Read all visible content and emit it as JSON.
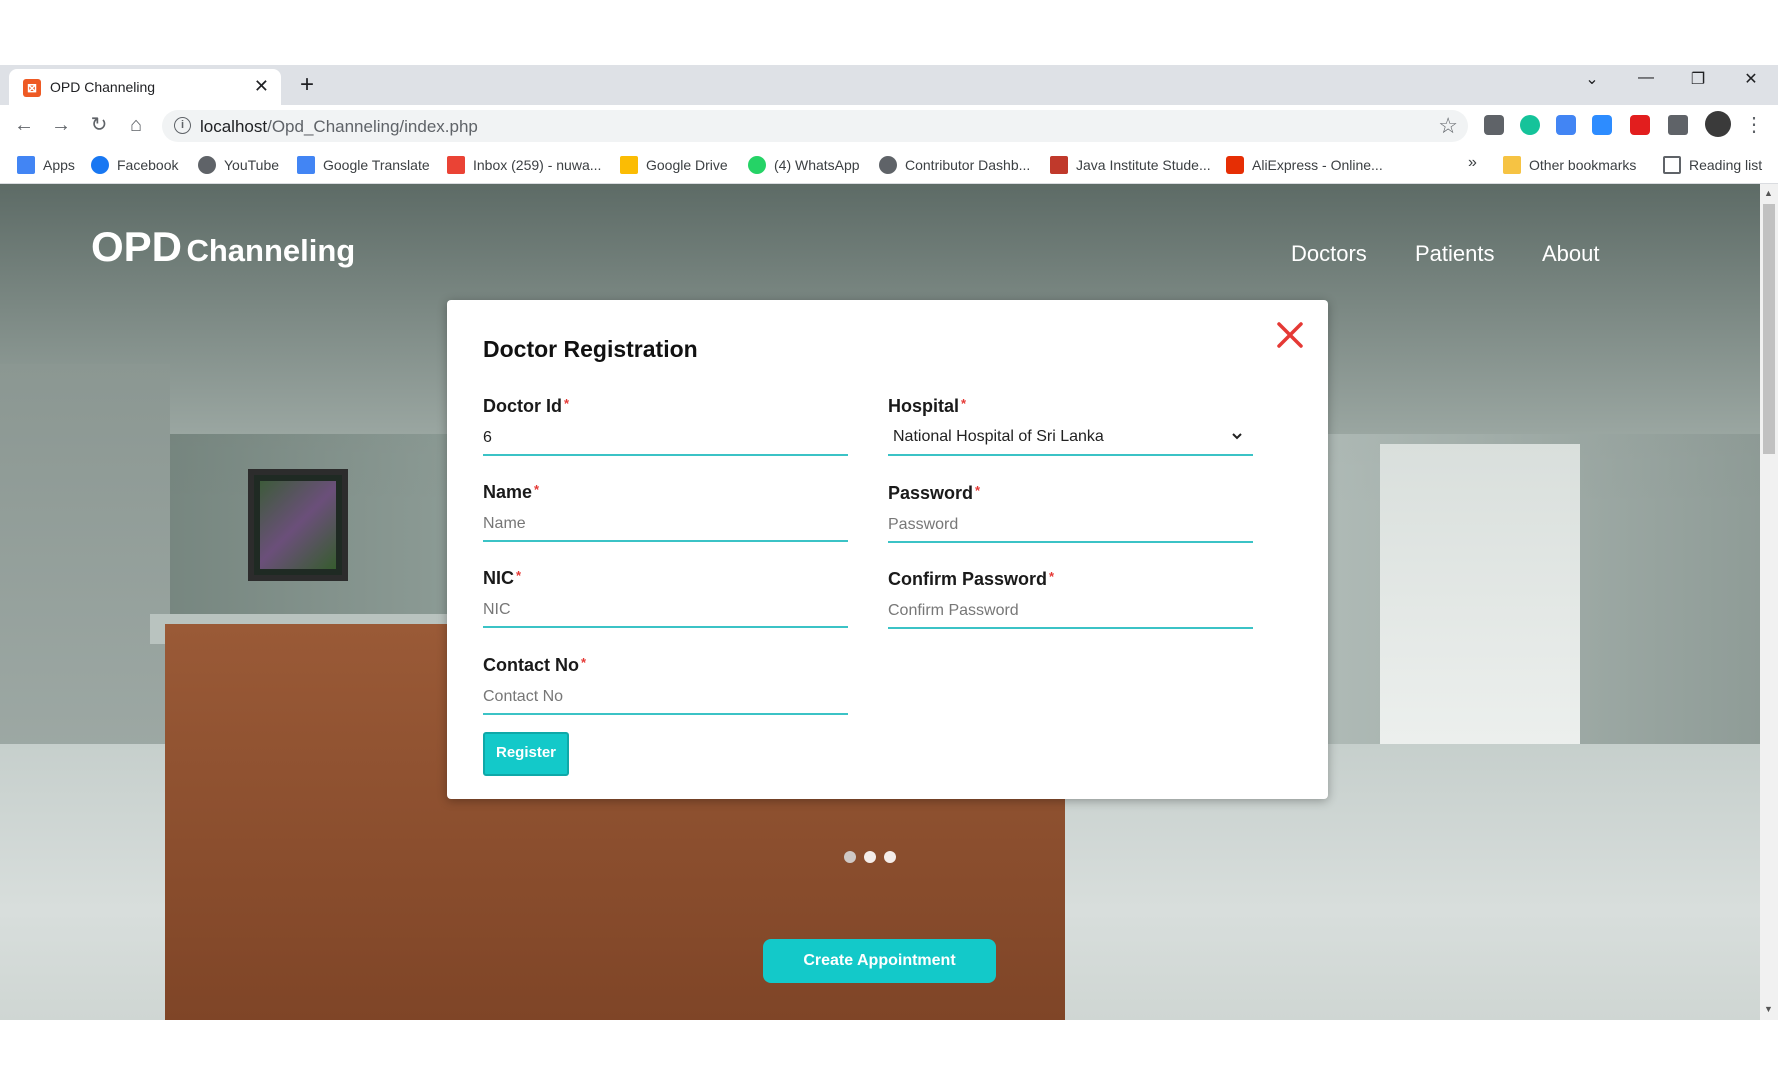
{
  "browser": {
    "tab_title": "OPD Channeling",
    "tab_close": "✕",
    "new_tab": "+",
    "url_host": "localhost",
    "url_path": "/Opd_Channeling/index.php",
    "bookmarks": [
      {
        "label": "Apps",
        "color": "#4285f4"
      },
      {
        "label": "Facebook",
        "color": "#1877f2"
      },
      {
        "label": "YouTube",
        "color": "#5f6368"
      },
      {
        "label": "Google Translate",
        "color": "#4285f4"
      },
      {
        "label": "Inbox (259) - nuwa...",
        "color": "#ea4335"
      },
      {
        "label": "Google Drive",
        "color": "#fbbc04"
      },
      {
        "label": "(4) WhatsApp",
        "color": "#25d366"
      },
      {
        "label": "Contributor Dashb...",
        "color": "#5f6368"
      },
      {
        "label": "Java Institute Stude...",
        "color": "#c0392b"
      },
      {
        "label": "AliExpress - Online...",
        "color": "#e62e04"
      }
    ],
    "more_bookmarks": "»",
    "other_bookmarks": "Other bookmarks",
    "reading_list": "Reading list"
  },
  "site": {
    "brand_main": "OPD",
    "brand_sub": "Channeling",
    "nav": [
      "Doctors",
      "Patients",
      "About"
    ],
    "create_button": "Create Appointment",
    "carousel_active_index": 0
  },
  "modal": {
    "title": "Doctor Registration",
    "fields": {
      "doctor_id": {
        "label": "Doctor Id",
        "value": "6"
      },
      "hospital": {
        "label": "Hospital",
        "value": "National Hospital of Sri Lanka"
      },
      "name": {
        "label": "Name",
        "placeholder": "Name"
      },
      "password": {
        "label": "Password",
        "placeholder": "Password"
      },
      "nic": {
        "label": "NIC",
        "placeholder": "NIC"
      },
      "confirm_password": {
        "label": "Confirm Password",
        "placeholder": "Confirm Password"
      },
      "contact_no": {
        "label": "Contact No",
        "placeholder": "Contact No"
      }
    },
    "required_mark": "*",
    "register_button": "Register"
  },
  "colors": {
    "accent": "#13c9c9",
    "close": "#e53935"
  }
}
